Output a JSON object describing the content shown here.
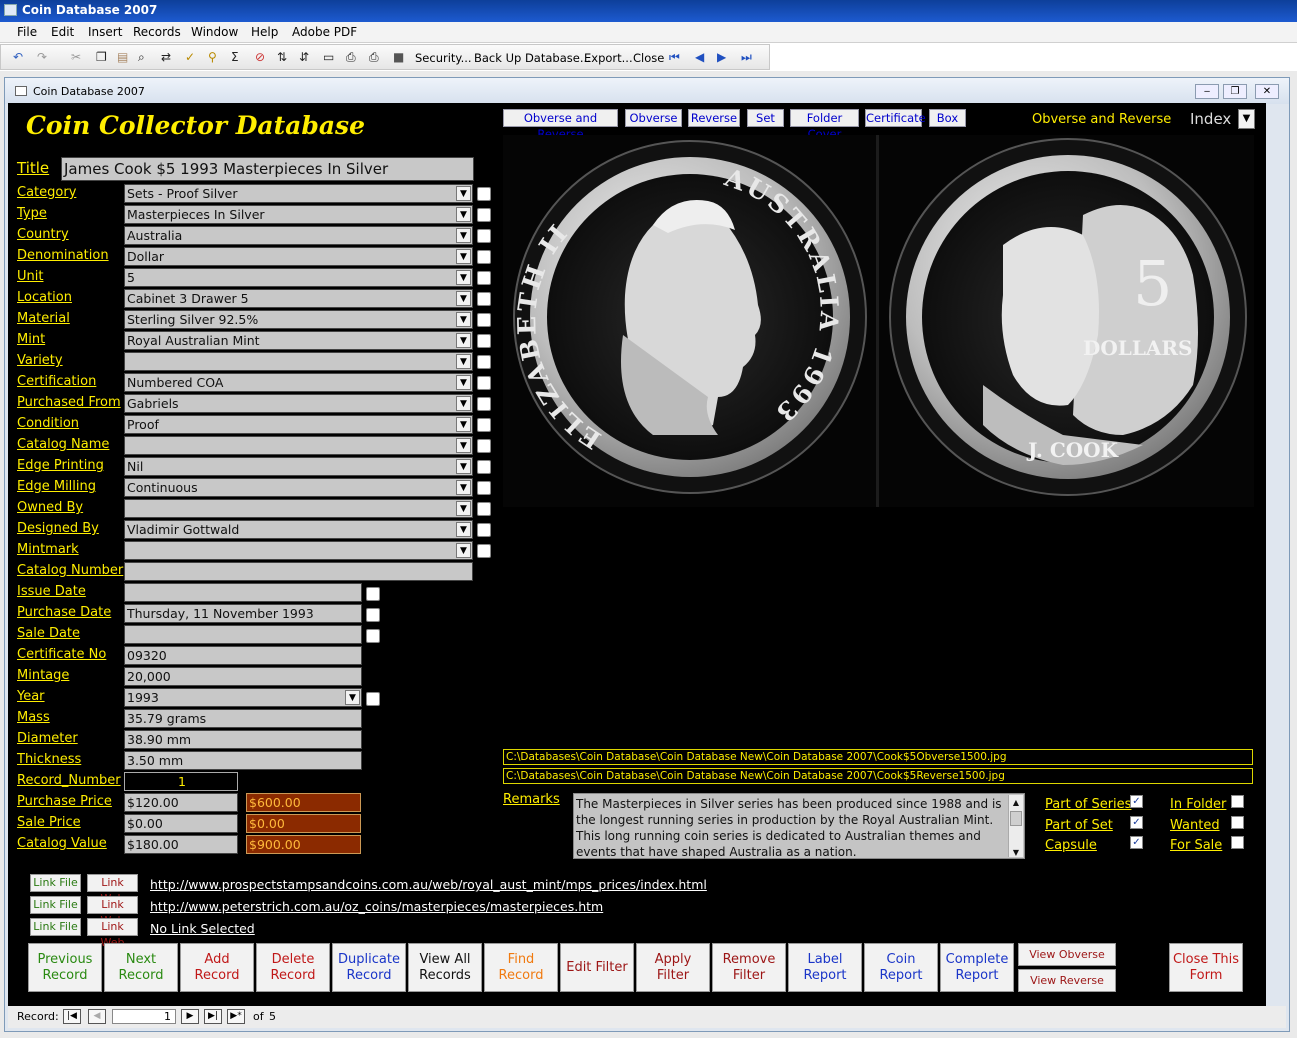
{
  "window_title": "Coin Database 2007",
  "menu": [
    "File",
    "Edit",
    "Insert",
    "Records",
    "Window",
    "Help",
    "Adobe PDF"
  ],
  "toolbar": {
    "items": [
      "Security...",
      "Back Up Database...",
      "Export...",
      "Close"
    ]
  },
  "mdi_title": "Coin Database 2007",
  "app_title": "Coin Collector Database",
  "title_field": {
    "label": "Title",
    "value": "James Cook $5 1993 Masterpieces In Silver"
  },
  "fields": [
    {
      "label": "Category",
      "value": "Sets - Proof Silver"
    },
    {
      "label": "Type",
      "value": "Masterpieces In Silver"
    },
    {
      "label": "Country",
      "value": "Australia"
    },
    {
      "label": "Denomination",
      "value": "Dollar"
    },
    {
      "label": "Unit",
      "value": "5"
    },
    {
      "label": "Location",
      "value": "Cabinet 3 Drawer 5"
    },
    {
      "label": "Material",
      "value": "Sterling Silver 92.5%"
    },
    {
      "label": "Mint",
      "value": "Royal Australian Mint"
    },
    {
      "label": "Variety",
      "value": ""
    },
    {
      "label": "Certification",
      "value": "Numbered COA"
    },
    {
      "label": "Purchased From",
      "value": "Gabriels"
    },
    {
      "label": "Condition",
      "value": "Proof"
    },
    {
      "label": "Catalog Name",
      "value": ""
    },
    {
      "label": "Edge Printing",
      "value": "Nil"
    },
    {
      "label": "Edge Milling",
      "value": "Continuous"
    },
    {
      "label": "Owned By",
      "value": ""
    },
    {
      "label": "Designed By",
      "value": "Vladimir Gottwald"
    },
    {
      "label": "Mintmark",
      "value": ""
    }
  ],
  "catalog_number": {
    "label": "Catalog Number",
    "value": ""
  },
  "dates": [
    {
      "label": "Issue Date",
      "value": ""
    },
    {
      "label": "Purchase Date",
      "value": "Thursday, 11 November 1993"
    },
    {
      "label": "Sale Date",
      "value": ""
    }
  ],
  "details": [
    {
      "label": "Certificate No",
      "value": "09320"
    },
    {
      "label": "Mintage",
      "value": "20,000"
    },
    {
      "label": "Year",
      "value": "1993"
    },
    {
      "label": "Mass",
      "value": "35.79 grams"
    },
    {
      "label": "Diameter",
      "value": "38.90 mm"
    },
    {
      "label": "Thickness",
      "value": "3.50 mm"
    }
  ],
  "record_number": {
    "label": "Record_Number",
    "value": "1"
  },
  "prices": [
    {
      "label": "Purchase Price",
      "value": "$120.00",
      "total": "$600.00"
    },
    {
      "label": "Sale Price",
      "value": "$0.00",
      "total": "$0.00"
    },
    {
      "label": "Catalog Value",
      "value": "$180.00",
      "total": "$900.00"
    }
  ],
  "image_tabs": [
    "Obverse and Reverse",
    "Obverse",
    "Reverse",
    "Set",
    "Folder Cover",
    "Certificate",
    "Box"
  ],
  "image_view_label": "Obverse and Reverse",
  "index_label": "Index",
  "coin_obverse": {
    "legend_left": "ELIZABETH II",
    "legend_right": "AUSTRALIA",
    "year": "1993"
  },
  "coin_reverse": {
    "value": "5",
    "dollars": "DOLLARS",
    "name": "J. COOK"
  },
  "paths": [
    "C:\\Databases\\Coin Database\\Coin Database New\\Coin Database 2007\\Cook$5Obverse1500.jpg",
    "C:\\Databases\\Coin Database\\Coin Database New\\Coin Database 2007\\Cook$5Reverse1500.jpg"
  ],
  "remarks": {
    "label": "Remarks",
    "text": "The Masterpieces in Silver series has been produced since 1988 and is the longest running series in production by the Royal Australian Mint. This long running coin series is dedicated to Australian themes and events that have shaped Australia as a nation."
  },
  "flags_left": [
    {
      "label": "Part of Series",
      "checked": true
    },
    {
      "label": "Part of Set",
      "checked": true
    },
    {
      "label": "Capsule",
      "checked": true
    }
  ],
  "flags_right": [
    {
      "label": "In Folder",
      "checked": false
    },
    {
      "label": "Wanted",
      "checked": false
    },
    {
      "label": "For Sale",
      "checked": false
    }
  ],
  "link_file_label": "Link File",
  "link_web_label": "Link Web",
  "links": [
    "http://www.prospectstampsandcoins.com.au/web/royal_aust_mint/mps_prices/index.html",
    "http://www.peterstrich.com.au/oz_coins/masterpieces/masterpieces.htm",
    "No Link Selected"
  ],
  "buttons": [
    {
      "label": "Previous Record",
      "color": "#2a8a12"
    },
    {
      "label": "Next Record",
      "color": "#2a8a12"
    },
    {
      "label": "Add Record",
      "color": "#c01818"
    },
    {
      "label": "Delete Record",
      "color": "#c01818"
    },
    {
      "label": "Duplicate Record",
      "color": "#1a35c8"
    },
    {
      "label": "View All Records",
      "color": "#111111"
    },
    {
      "label": "Find Record",
      "color": "#f07a10"
    },
    {
      "label": "Edit Filter",
      "color": "#9c1515"
    },
    {
      "label": "Apply Filter",
      "color": "#9c1515"
    },
    {
      "label": "Remove Filter",
      "color": "#9c1515"
    },
    {
      "label": "Label Report",
      "color": "#1a35c8"
    },
    {
      "label": "Coin Report",
      "color": "#1a35c8"
    },
    {
      "label": "Complete Report",
      "color": "#1a35c8"
    }
  ],
  "view_obverse": "View Obverse",
  "view_reverse": "View Reverse",
  "close_form": "Close This Form",
  "nav": {
    "label": "Record:",
    "current": "1",
    "of": "of",
    "total": "5"
  },
  "colors": {
    "form_bg": "#000000",
    "label": "#ffee00",
    "field": "#c8c8c8",
    "price_total_bg": "#8b2a00"
  }
}
